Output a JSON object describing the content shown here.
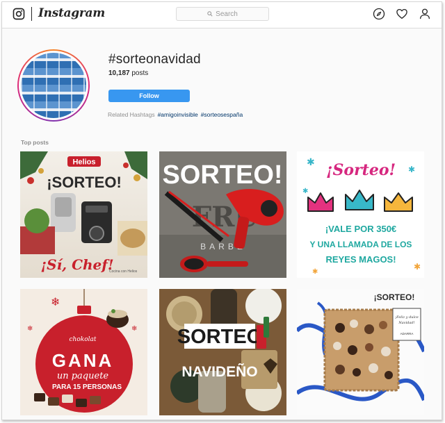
{
  "header": {
    "wordmark": "Instagram",
    "search_placeholder": "Search"
  },
  "hashtag": {
    "title": "#sorteonavidad",
    "post_count": "10,187",
    "post_count_suffix": "posts",
    "follow_label": "Follow",
    "related_label": "Related Hashtags",
    "related": [
      "#amigoinvisible",
      "#sorteosespaña"
    ]
  },
  "top_posts_label": "Top posts",
  "posts": [
    {
      "brand": "Helios",
      "headline": "¡SORTEO!",
      "slogan": "¡Sí, Chef!",
      "tagline": "Cocina con Helios"
    },
    {
      "headline": "SORTEO!",
      "brand_fragment": "FRU",
      "brand_sub": "BARBE"
    },
    {
      "headline": "¡Sorteo!",
      "line1": "¡VALE POR 350€",
      "line2": "Y UNA LLAMADA DE LOS",
      "line3": "REYES MAGOS!"
    },
    {
      "brand": "chokolat",
      "headline": "GANA",
      "line1": "un paquete",
      "line2": "PARA 15 PERSONAS"
    },
    {
      "headline": "SORTEO",
      "sub": "NAVIDEÑO"
    },
    {
      "headline": "¡SORTEO!",
      "card_line1": "¡Feliz y dulce",
      "card_line2": "Navidad!",
      "card_brand": "ADARRA"
    }
  ],
  "colors": {
    "follow_bg": "#3897f0",
    "link": "#003569",
    "post2_red": "#d81e1e",
    "post3_headline": "#d6277f",
    "post3_text": "#1fa8a0",
    "post4_red": "#c8202c"
  },
  "icons": [
    "instagram-camera-icon",
    "search-icon",
    "compass-icon",
    "heart-icon",
    "user-icon"
  ]
}
